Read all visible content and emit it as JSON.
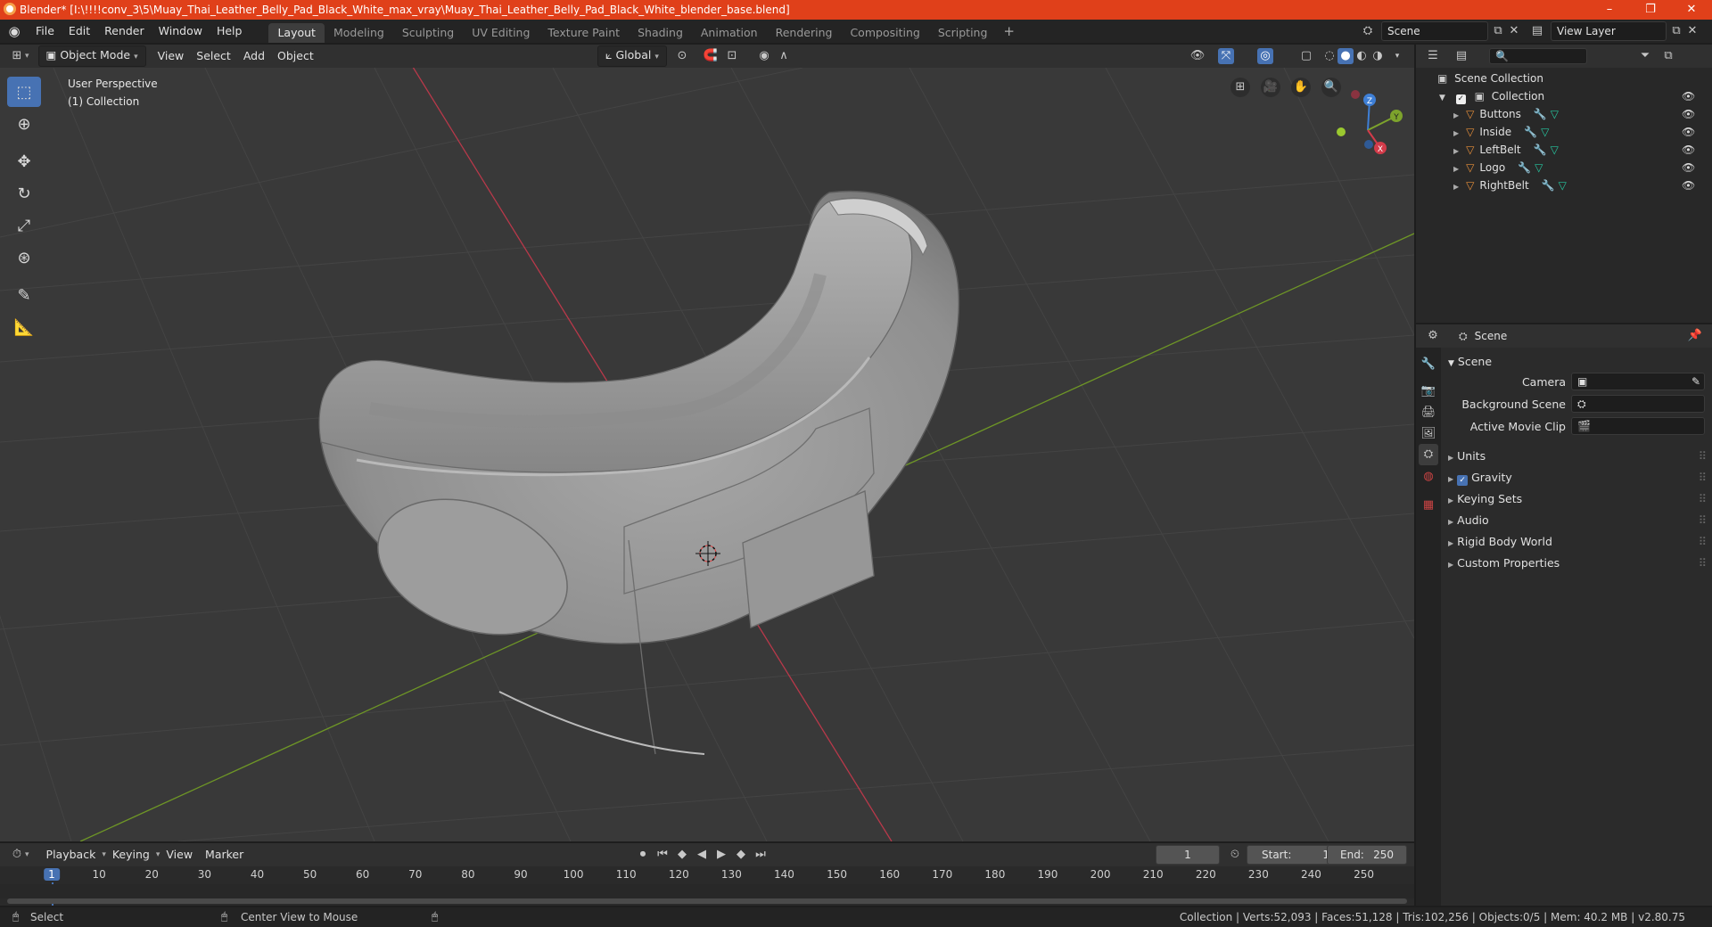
{
  "window": {
    "title": "Blender* [I:\\!!!!conv_3\\5\\Muay_Thai_Leather_Belly_Pad_Black_White_max_vray\\Muay_Thai_Leather_Belly_Pad_Black_White_blender_base.blend]",
    "controls": [
      "–",
      "❐",
      "✕"
    ]
  },
  "menu": [
    "File",
    "Edit",
    "Render",
    "Window",
    "Help"
  ],
  "workspaces": [
    "Layout",
    "Modeling",
    "Sculpting",
    "UV Editing",
    "Texture Paint",
    "Shading",
    "Animation",
    "Rendering",
    "Compositing",
    "Scripting"
  ],
  "active_workspace": "Layout",
  "scene_field": "Scene",
  "view_layer_field": "View Layer",
  "viewport_header": {
    "mode": "Object Mode",
    "menus": [
      "View",
      "Select",
      "Add",
      "Object"
    ],
    "orientation": "Global"
  },
  "viewport": {
    "perspective": "User Perspective",
    "collection": "(1) Collection",
    "gizmo_axes": [
      "Z",
      "Y",
      "X"
    ]
  },
  "outliner": {
    "root": "Scene Collection",
    "collection": "Collection",
    "objects": [
      "Buttons",
      "Inside",
      "LeftBelt",
      "Logo",
      "RightBelt"
    ]
  },
  "properties": {
    "header": "Scene",
    "section": "Scene",
    "fields": [
      {
        "label": "Camera",
        "value": ""
      },
      {
        "label": "Background Scene",
        "value": ""
      },
      {
        "label": "Active Movie Clip",
        "value": ""
      }
    ],
    "panels": [
      "Units",
      "Gravity",
      "Keying Sets",
      "Audio",
      "Rigid Body World",
      "Custom Properties"
    ],
    "gravity_checked": true
  },
  "timeline": {
    "menus": [
      "Playback",
      "Keying",
      "View",
      "Marker"
    ],
    "current_frame": "1",
    "start_label": "Start:",
    "start": "1",
    "end_label": "End:",
    "end": "250",
    "ruler": [
      "1",
      "10",
      "20",
      "30",
      "40",
      "50",
      "60",
      "70",
      "80",
      "90",
      "100",
      "110",
      "120",
      "130",
      "140",
      "150",
      "160",
      "170",
      "180",
      "190",
      "200",
      "210",
      "220",
      "230",
      "240",
      "250"
    ]
  },
  "statusbar": {
    "left": "Select",
    "middle": "Center View to Mouse",
    "right": "Collection | Verts:52,093 | Faces:51,128 | Tris:102,256 | Objects:0/5 | Mem: 40.2 MB | v2.80.75"
  },
  "colors": {
    "titlebar": "#e0401a",
    "accent": "#4772b3",
    "x_axis": "#d33b4a",
    "y_axis": "#7da32c",
    "z_axis": "#3e7fd6"
  }
}
